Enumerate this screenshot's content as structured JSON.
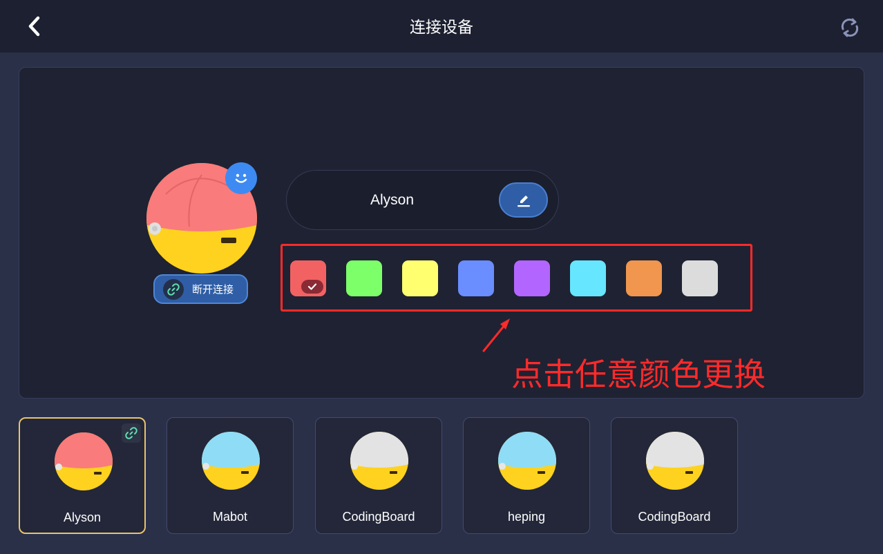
{
  "header": {
    "title": "连接设备",
    "back_icon": "chevron-left-icon",
    "refresh_icon": "refresh-icon"
  },
  "device_panel": {
    "device_name": "Alyson",
    "robot_color": "#f97b7b",
    "disconnect_label": "断开连接",
    "edit_icon": "pencil-icon",
    "status_icon": "smile-icon"
  },
  "color_options": [
    {
      "name": "red",
      "color": "#f26262",
      "selected": true
    },
    {
      "name": "green",
      "color": "#7dff6a",
      "selected": false
    },
    {
      "name": "yellow",
      "color": "#ffff70",
      "selected": false
    },
    {
      "name": "blue",
      "color": "#6a8dff",
      "selected": false
    },
    {
      "name": "purple",
      "color": "#b366ff",
      "selected": false
    },
    {
      "name": "cyan",
      "color": "#66e6ff",
      "selected": false
    },
    {
      "name": "orange",
      "color": "#f0964f",
      "selected": false
    },
    {
      "name": "gray",
      "color": "#dcdcdc",
      "selected": false
    }
  ],
  "annotation": {
    "text": "点击任意颜色更换",
    "color": "#ff2a2a"
  },
  "devices": [
    {
      "label": "Alyson",
      "color": "#f97b7b",
      "selected": true,
      "connected": true
    },
    {
      "label": "Mabot",
      "color": "#8fdcf7",
      "selected": false,
      "connected": false
    },
    {
      "label": "CodingBoard",
      "color": "#e3e3e3",
      "selected": false,
      "connected": false
    },
    {
      "label": "heping",
      "color": "#8fdcf7",
      "selected": false,
      "connected": false
    },
    {
      "label": "CodingBoard",
      "color": "#e3e3e3",
      "selected": false,
      "connected": false
    }
  ]
}
